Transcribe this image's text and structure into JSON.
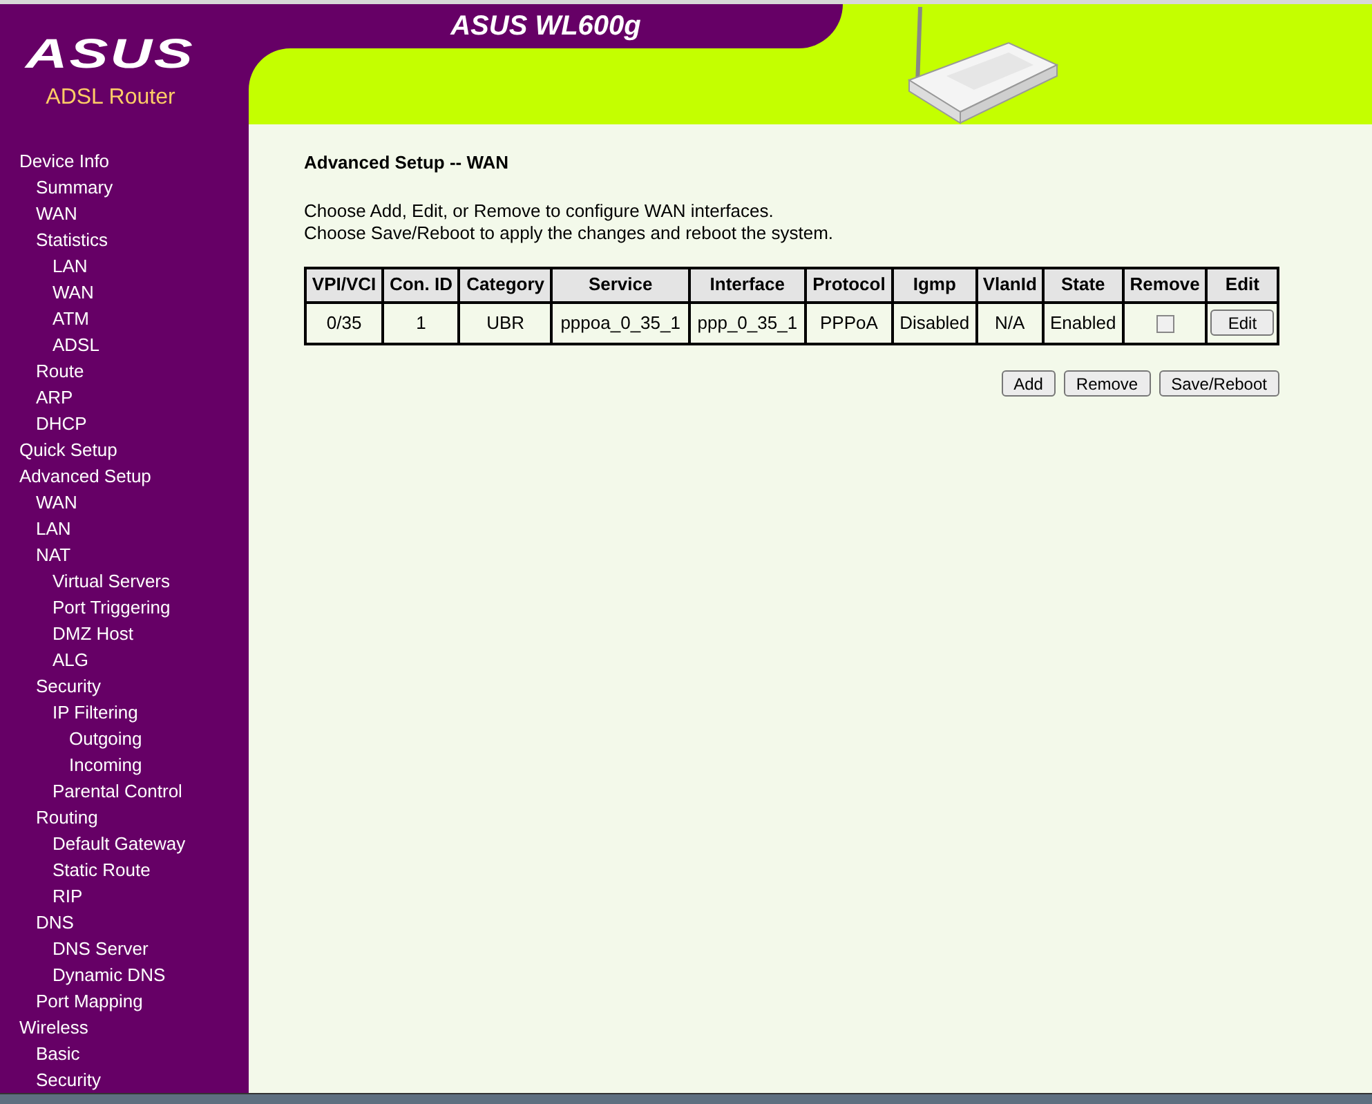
{
  "header": {
    "logo": "ASUS",
    "subtitle": "ADSL Router",
    "title": "ASUS WL600g"
  },
  "sidebar": {
    "items": [
      {
        "label": "Device Info",
        "children": [
          {
            "label": "Summary"
          },
          {
            "label": "WAN"
          },
          {
            "label": "Statistics",
            "children": [
              {
                "label": "LAN"
              },
              {
                "label": "WAN"
              },
              {
                "label": "ATM"
              },
              {
                "label": "ADSL"
              }
            ]
          },
          {
            "label": "Route"
          },
          {
            "label": "ARP"
          },
          {
            "label": "DHCP"
          }
        ]
      },
      {
        "label": "Quick Setup"
      },
      {
        "label": "Advanced Setup",
        "children": [
          {
            "label": "WAN"
          },
          {
            "label": "LAN"
          },
          {
            "label": "NAT",
            "children": [
              {
                "label": "Virtual Servers"
              },
              {
                "label": "Port Triggering"
              },
              {
                "label": "DMZ Host"
              },
              {
                "label": "ALG"
              }
            ]
          },
          {
            "label": "Security",
            "children": [
              {
                "label": "IP Filtering",
                "children": [
                  {
                    "label": "Outgoing"
                  },
                  {
                    "label": "Incoming"
                  }
                ]
              },
              {
                "label": "Parental Control"
              }
            ]
          },
          {
            "label": "Routing",
            "children": [
              {
                "label": "Default Gateway"
              },
              {
                "label": "Static Route"
              },
              {
                "label": "RIP"
              }
            ]
          },
          {
            "label": "DNS",
            "children": [
              {
                "label": "DNS Server"
              },
              {
                "label": "Dynamic DNS"
              }
            ]
          },
          {
            "label": "Port Mapping"
          }
        ]
      },
      {
        "label": "Wireless",
        "children": [
          {
            "label": "Basic"
          },
          {
            "label": "Security"
          }
        ]
      }
    ]
  },
  "page": {
    "heading": "Advanced Setup -- WAN",
    "intro": [
      "Choose Add, Edit, or Remove to configure WAN interfaces.",
      "Choose Save/Reboot to apply the changes and reboot the system."
    ]
  },
  "table": {
    "columns": [
      "VPI/VCI",
      "Con. ID",
      "Category",
      "Service",
      "Interface",
      "Protocol",
      "Igmp",
      "VlanId",
      "State",
      "Remove",
      "Edit"
    ],
    "rows": [
      {
        "cells": [
          "0/35",
          "1",
          "UBR",
          "pppoa_0_35_1",
          "ppp_0_35_1",
          "PPPoA",
          "Disabled",
          "N/A",
          "Enabled"
        ],
        "remove_checked": false,
        "edit_button": "Edit"
      }
    ]
  },
  "buttons": [
    "Add",
    "Remove",
    "Save/Reboot"
  ]
}
